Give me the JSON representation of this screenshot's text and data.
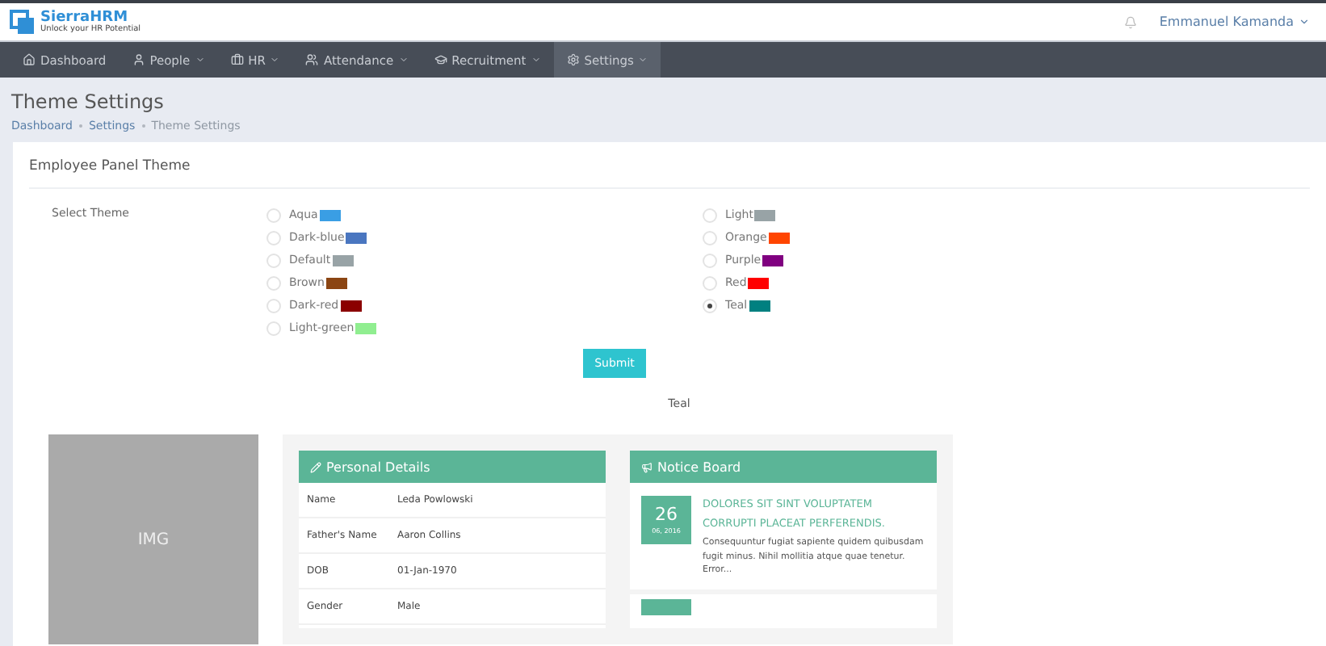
{
  "brand": {
    "name": "SierraHRM",
    "tagline": "Unlock your HR Potential"
  },
  "user": {
    "name": "Emmanuel Kamanda"
  },
  "nav": [
    {
      "label": "Dashboard",
      "dropdown": false,
      "selected": false
    },
    {
      "label": "People",
      "dropdown": true,
      "selected": false
    },
    {
      "label": "HR",
      "dropdown": true,
      "selected": false
    },
    {
      "label": "Attendance",
      "dropdown": true,
      "selected": false
    },
    {
      "label": "Recruitment",
      "dropdown": true,
      "selected": false
    },
    {
      "label": "Settings",
      "dropdown": true,
      "selected": true
    }
  ],
  "page_title": "Theme Settings",
  "breadcrumb": [
    "Dashboard",
    "Settings",
    "Theme Settings"
  ],
  "card_title": "Employee Panel Theme",
  "field_label": "Select Theme",
  "themes_left": [
    {
      "label": "Aqua",
      "color": "#3a9ee4",
      "selected": false
    },
    {
      "label": "Dark-blue",
      "color": "#4a76c0",
      "selected": false
    },
    {
      "label": "Default",
      "color": "#98a3a6",
      "selected": false
    },
    {
      "label": "Brown",
      "color": "#8b4513",
      "selected": false
    },
    {
      "label": "Dark-red",
      "color": "#8b0000",
      "selected": false
    },
    {
      "label": "Light-green",
      "color": "#90ee90",
      "selected": false
    }
  ],
  "themes_right": [
    {
      "label": "Light",
      "color": "#98a3a6",
      "selected": false
    },
    {
      "label": "Orange",
      "color": "#ff4500",
      "selected": false
    },
    {
      "label": "Purple",
      "color": "#800080",
      "selected": false
    },
    {
      "label": "Red",
      "color": "#ff0000",
      "selected": false
    },
    {
      "label": "Teal",
      "color": "#008080",
      "selected": true
    }
  ],
  "submit": "Submit",
  "current_theme": "Teal",
  "preview": {
    "image_label": "IMG",
    "personal_title": "Personal Details",
    "personal_rows": [
      {
        "label": "Name",
        "value": "Leda Powlowski"
      },
      {
        "label": "Father's Name",
        "value": "Aaron Collins"
      },
      {
        "label": "DOB",
        "value": "01-Jan-1970"
      },
      {
        "label": "Gender",
        "value": "Male"
      }
    ],
    "notice_title": "Notice Board",
    "notices": [
      {
        "day": "26",
        "month_year": "06, 2016",
        "title": "DOLORES SIT SINT VOLUPTATEM CORRUPTI PLACEAT PERFERENDIS.",
        "body": "Consequuntur fugiat sapiente quidem quibusdam fugit minus. Nihil mollitia atque quae tenetur. Error..."
      }
    ]
  }
}
